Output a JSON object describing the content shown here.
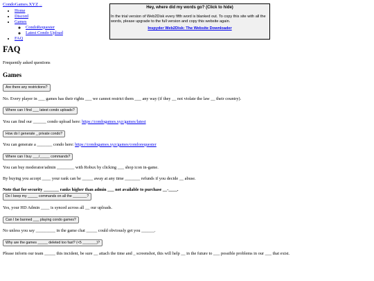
{
  "site": {
    "name": "CondoGames.XYZ",
    "arrow": "—"
  },
  "nav": {
    "items": [
      {
        "label": "Home"
      },
      {
        "label": "Discord"
      },
      {
        "label": "Games"
      }
    ],
    "sub_items": [
      {
        "label": "CondoRequester"
      },
      {
        "label": "Latest Condo Upload"
      }
    ],
    "faq": "FAQ"
  },
  "page": {
    "title": "FAQ",
    "subtitle": "Frequently asked questions",
    "section": "Games"
  },
  "faq": [
    {
      "q": "Are there any restrictions?",
      "a": "No. Every player in ___ games has their rights ___ we cannot restrict them ___ any way (if they __ not violate the law __ their country)."
    },
    {
      "q": "Where can I find ___ latest condo uploads?",
      "a_pre": "You can find our ______ condo upload here: ",
      "a_link": "https://condogames.xyz/games/latest"
    },
    {
      "q": "How do I generate _ private condo?",
      "a_pre": "You can generate a _______ condo here: ",
      "a_link": "https://condogames.xyz/games/condorequester"
    },
    {
      "q": "Where can I buy ___/_____ commands?",
      "a": "You can buy moderator/admin ________ with Robux by clicking ___ shop icon in-game."
    },
    {
      "q": "",
      "a": "By buying you accept ____ your rank can be _____ away at any time _______ refunds if you decide __ abuse."
    }
  ],
  "note": "Note that for security _______ ranks higher than admin ___ not available to purchase __-____.",
  "faq2": [
    {
      "q": "Do I keep my _____ commands on all the _______?",
      "a": "Yes, your HD Admin ____ is synced across all __ our uploads."
    },
    {
      "q": "Can I be banned ___ playing condo games?",
      "a": "No unless you say _________ in the game chat _____ could obviously get you ______."
    },
    {
      "q": "Why are the games _____ deleted too fast? (<5 _______)?",
      "a": "Please inform our team _____ this incident, be sure __ attach the time and _ screenshot, this will help __ in the future to ___ possible problems in our ___ that exist."
    }
  ],
  "popup": {
    "title": "Hey, where did my words go? (Click to hide)",
    "body": "In the trial version of Web2Disk every fifth word is blanked out. To copy this site with all the words, please upgrade to the full version and copy this website again.",
    "link": "Inspyder Web2Disk: The Website Downloader"
  }
}
